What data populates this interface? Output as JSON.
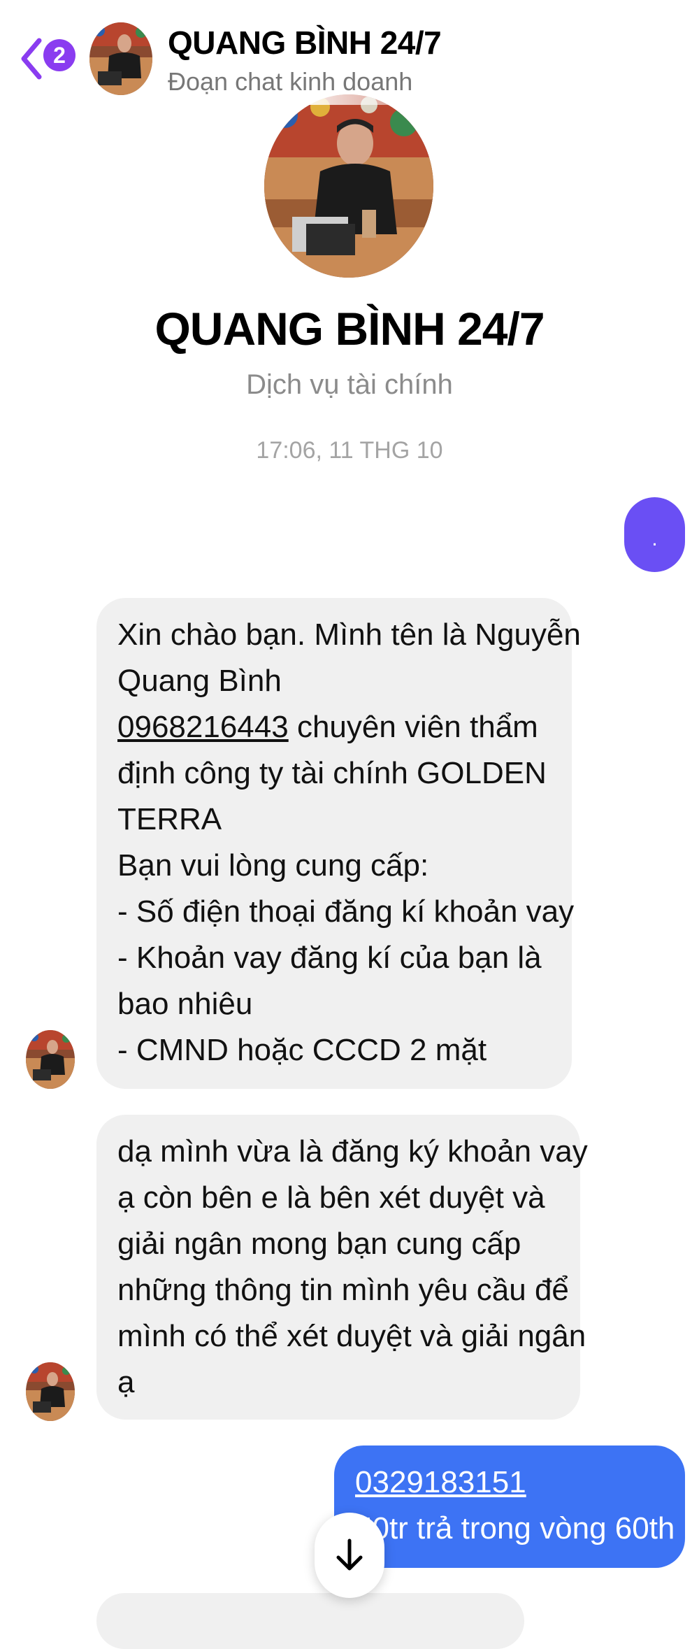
{
  "header": {
    "back_badge": "2",
    "title": "QUANG BÌNH 24/7",
    "subtitle": "Đoạn chat kinh doanh"
  },
  "profile": {
    "name": "QUANG BÌNH 24/7",
    "category": "Dịch vụ tài chính"
  },
  "timestamp": "17:06, 11 THG 10",
  "sent_dot": ".",
  "messages_in": [
    {
      "lines": [
        "Xin chào bạn. Mình tên là Nguyễn",
        "Quang Bình"
      ],
      "phone": "0968216443",
      "phone_suffix": " chuyên viên thẩm",
      "rest": [
        "định công ty tài chính  GOLDEN",
        "TERRA",
        "Bạn vui lòng cung cấp:",
        "- Số điện thoại đăng kí khoản vay",
        "- Khoản vay đăng kí của bạn là",
        "bao nhiêu",
        "- CMND hoặc CCCD 2 mặt"
      ]
    },
    {
      "lines": [
        "dạ mình vừa là đăng ký khoản vay",
        "ạ còn bên e là bên xét duyệt và",
        "giải ngân mong bạn cung cấp",
        "những thông tin mình yêu cầu để",
        "mình có thể xét duyệt và giải ngân",
        "ạ"
      ]
    }
  ],
  "message_out": {
    "phone": "0329183151",
    "line2": "50tr trả trong vòng 60th"
  },
  "colors": {
    "accent": "#8a3cf0",
    "sent_bubble": "#3d73f4",
    "dot_bubble": "#6a4ff4",
    "incoming_bubble": "#f0f0f0"
  },
  "icons": {
    "back": "chevron-left-icon",
    "scroll": "arrow-down-icon"
  }
}
